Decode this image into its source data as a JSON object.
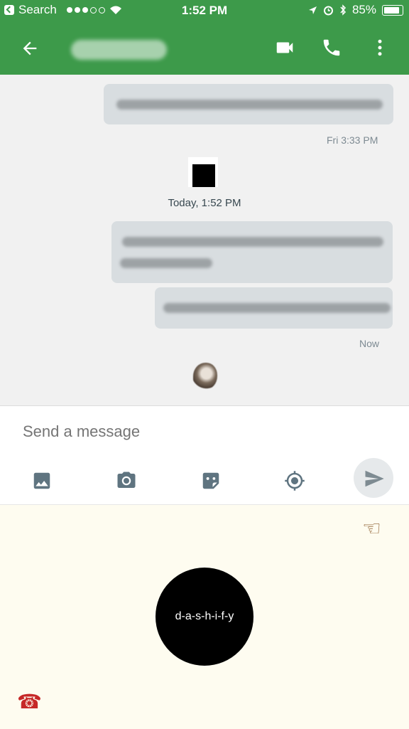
{
  "status_bar": {
    "back_label": "Search",
    "time": "1:52 PM",
    "battery": "85%"
  },
  "icons": [
    "arrow-back-icon",
    "video-call-icon",
    "phone-icon",
    "more-vert-icon",
    "image-icon",
    "camera-icon",
    "sticker-icon",
    "location-icon",
    "send-icon",
    "pointing-hand-icon",
    "telephone-icon"
  ],
  "colors": {
    "app_bar": "#3d9a4a",
    "bubble": "#d8dde0",
    "keyboard_bg": "#fefcf0"
  },
  "messages": {
    "timestamp_1": "Fri 3:33 PM",
    "today_header": "Today, 1:52 PM",
    "timestamp_2": "Now"
  },
  "composer": {
    "placeholder": "Send a message"
  },
  "keyboard": {
    "center_label": "d-a-s-h-i-f-y",
    "hand_glyph": "☜",
    "phone_glyph": "☎"
  }
}
